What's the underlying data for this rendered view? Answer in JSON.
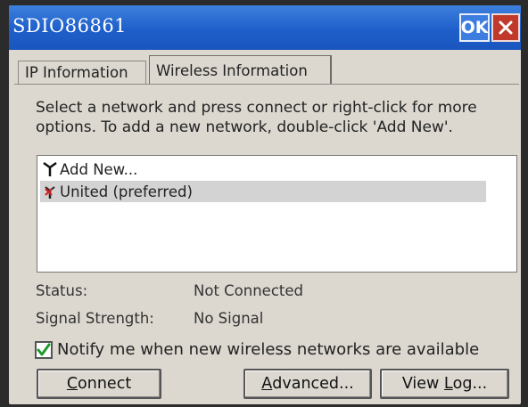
{
  "window": {
    "title": "SDIO86861",
    "ok_label": "OK"
  },
  "tabs": [
    {
      "label": "IP Information",
      "active": false
    },
    {
      "label": "Wireless Information",
      "active": true
    }
  ],
  "instructions": "Select a network and press connect or right-click for more options.  To add a new network, double-click 'Add New'.",
  "networks": [
    {
      "label": "Add New...",
      "icon": "antenna-icon",
      "selected": false
    },
    {
      "label": "United (preferred)",
      "icon": "antenna-disconnected-icon",
      "selected": true
    }
  ],
  "status": {
    "status_label": "Status:",
    "status_value": "Not Connected",
    "signal_label": "Signal Strength:",
    "signal_value": "No Signal"
  },
  "notify": {
    "label": "Notify me when new wireless networks are available",
    "checked": true
  },
  "buttons": {
    "connect": {
      "first": "C",
      "rest": "onnect"
    },
    "advanced": {
      "first": "A",
      "rest": "dvanced..."
    },
    "viewlog": {
      "pre": "View ",
      "first": "L",
      "rest": "og..."
    }
  },
  "colors": {
    "titlebar": "#1f5fcb",
    "close": "#c0392b",
    "check": "#1f9a2a"
  }
}
